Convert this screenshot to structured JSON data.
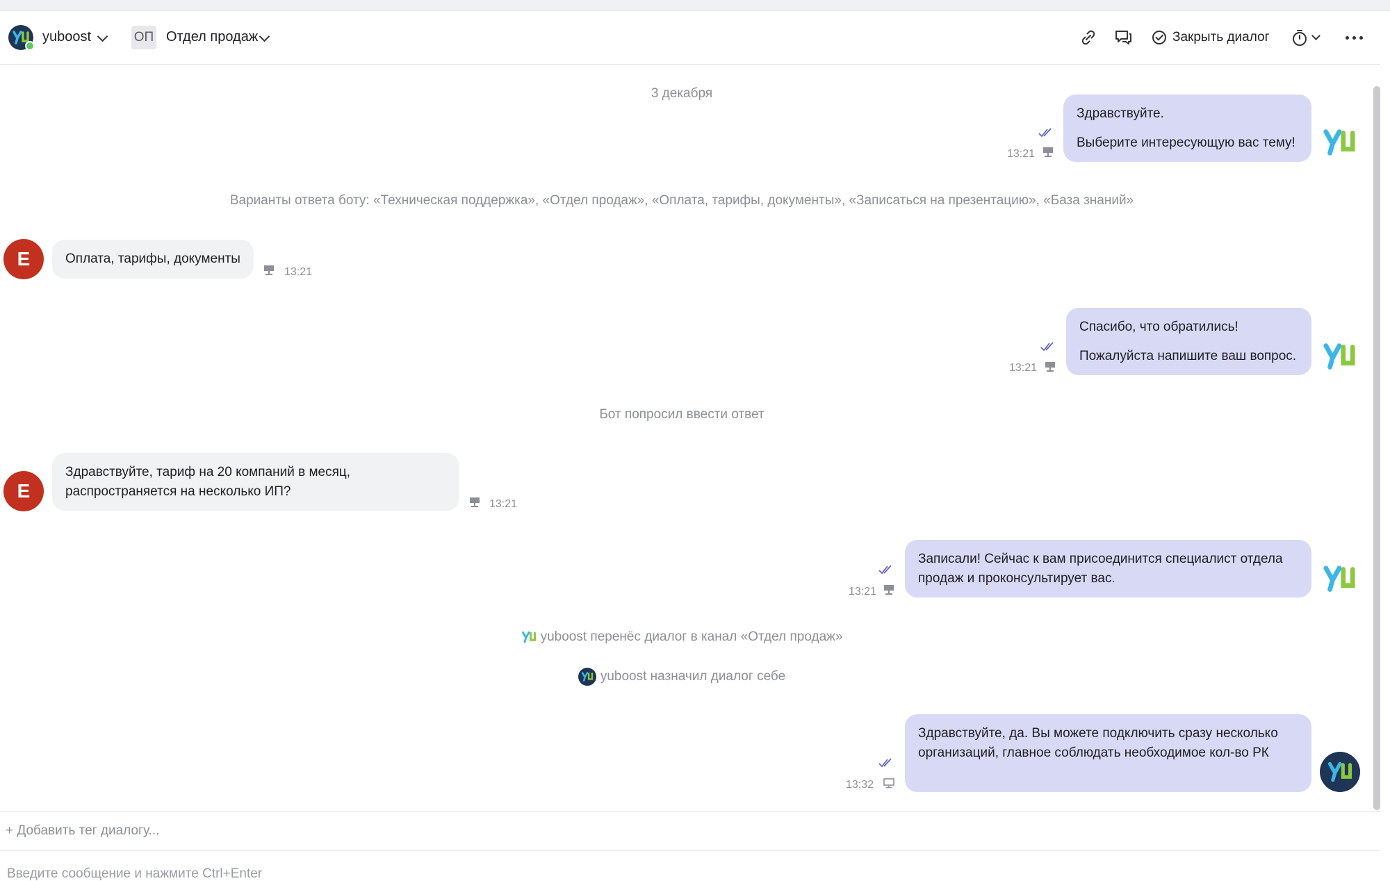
{
  "header": {
    "bot_name": "yuboost",
    "dept_badge": "ОП",
    "dept_name": "Отдел продаж",
    "close_label": "Закрыть диалог"
  },
  "chat": {
    "date": "3 декабря",
    "messages": [
      {
        "side": "out",
        "lines": [
          "Здравствуйте.",
          "Выберите интересующую вас тему!"
        ],
        "time": "13:21"
      },
      {
        "side": "in",
        "author_initial": "Е",
        "lines": [
          "Оплата, тарифы, документы"
        ],
        "time": "13:21"
      },
      {
        "side": "out",
        "lines": [
          "Спасибо, что обратились!",
          "Пожалуйста напишите ваш вопрос."
        ],
        "time": "13:21"
      },
      {
        "side": "in",
        "author_initial": "Е",
        "lines": [
          "Здравствуйте, тариф на 20 компаний в месяц, распространяется на несколько ИП?"
        ],
        "time": "13:21"
      },
      {
        "side": "out",
        "lines": [
          "Записали! Сейчас к вам присоединится специалист отдела продаж и проконсультирует вас."
        ],
        "time": "13:21"
      },
      {
        "side": "out",
        "lines": [
          "Здравствуйте, да. Вы можете подключить сразу несколько организаций, главное соблюдать необходимое кол-во РК"
        ],
        "time": "13:32"
      }
    ],
    "system": {
      "bot_options": "Варианты ответа боту: «Техническая поддержка», «Отдел продаж», «Оплата, тарифы, документы», «Записаться на презентацию», «База знаний»",
      "bot_asked": "Бот попросил ввести ответ",
      "transfer": "yuboost перенёс диалог в канал «Отдел продаж»",
      "assigned": "yuboost назначил диалог себе"
    }
  },
  "footer": {
    "add_tag": "+ Добавить тег диалогу...",
    "composer_placeholder": "Введите сообщение и нажмите Ctrl+Enter"
  },
  "colors": {
    "outgoing_bubble": "#d8d9f5",
    "incoming_bubble": "#f1f2f4",
    "user_avatar": "#c2311f",
    "operator_avatar": "#1f3556",
    "logo_blue": "#3ab7e6",
    "logo_green": "#8bc83f",
    "online": "#5ccb5f"
  }
}
